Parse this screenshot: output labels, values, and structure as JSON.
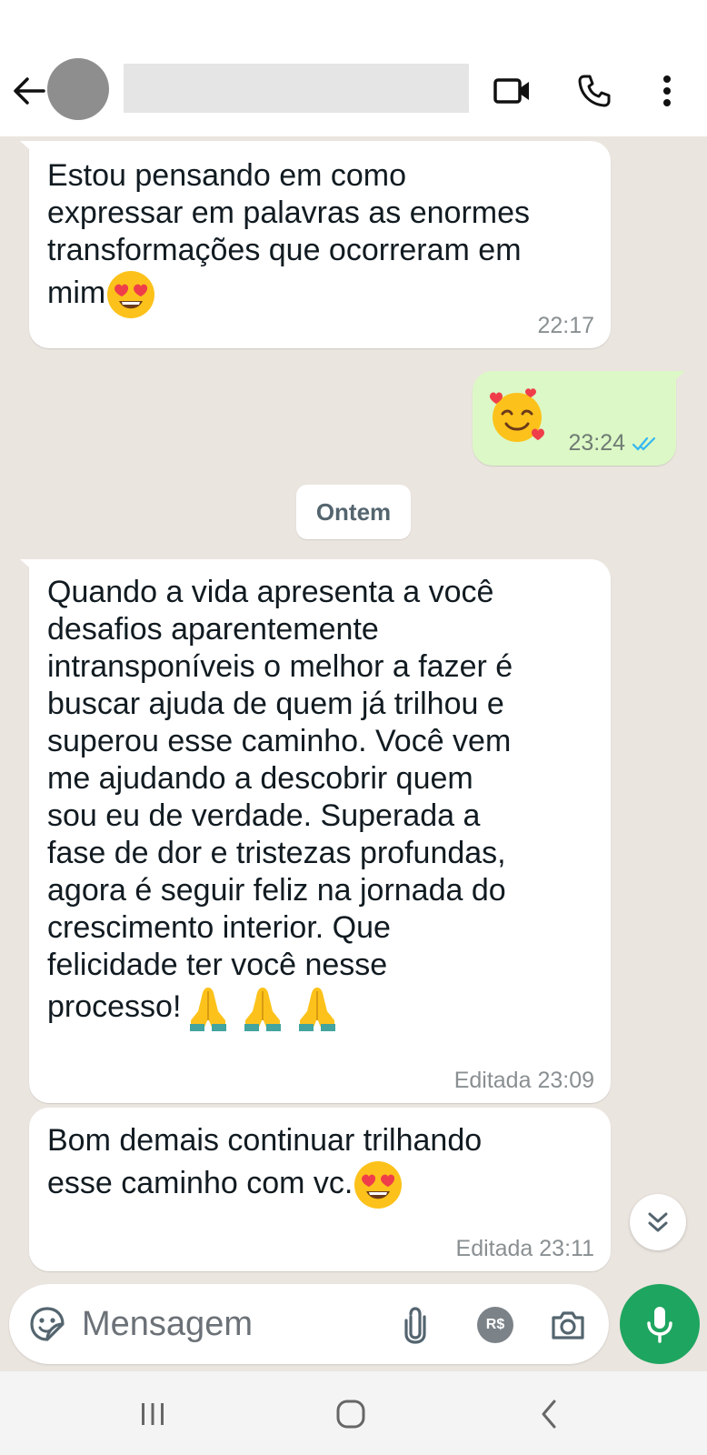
{
  "header": {
    "back_icon": "arrow-left-icon",
    "video_icon": "videocam-icon",
    "call_icon": "phone-icon",
    "menu_icon": "more-vertical-icon"
  },
  "messages": [
    {
      "direction": "incoming",
      "text": "Estou pensando em como\nexpressar em palavras as enormes\ntransformações que ocorreram em\nmim",
      "emoji": "heart-eyes-emoji",
      "time": "22:17"
    },
    {
      "direction": "outgoing",
      "emoji": "smiling-face-with-hearts-emoji",
      "time": "23:24",
      "status": "read"
    },
    {
      "direction": "incoming",
      "text": "Quando a vida apresenta a você\ndesafios aparentemente\nintransponíveis o melhor a fazer é\nbuscar ajuda de quem já trilhou e\nsuperou esse caminho. Você vem\nme ajudando a descobrir quem\nsou eu de verdade. Superada a\nfase de dor e tristezas profundas,\nagora é seguir feliz na jornada do\ncrescimento interior. Que\nfelicidade ter você nesse\nprocesso!",
      "emoji": "folded-hands-emoji",
      "emoji_count": 3,
      "time": "Editada 23:09"
    },
    {
      "direction": "incoming",
      "text": "Bom demais continuar trilhando\nesse caminho com vc.",
      "emoji": "heart-eyes-emoji",
      "time": "Editada 23:11"
    }
  ],
  "date_divider": "Ontem",
  "composer": {
    "placeholder": "Mensagem",
    "pay_label": "R$"
  },
  "colors": {
    "chat_bg": "#ebe5df",
    "outgoing_bubble": "#dcf8c6",
    "incoming_bubble": "#ffffff",
    "mic_button": "#1ea55f",
    "read_ticks": "#34b7f1"
  }
}
